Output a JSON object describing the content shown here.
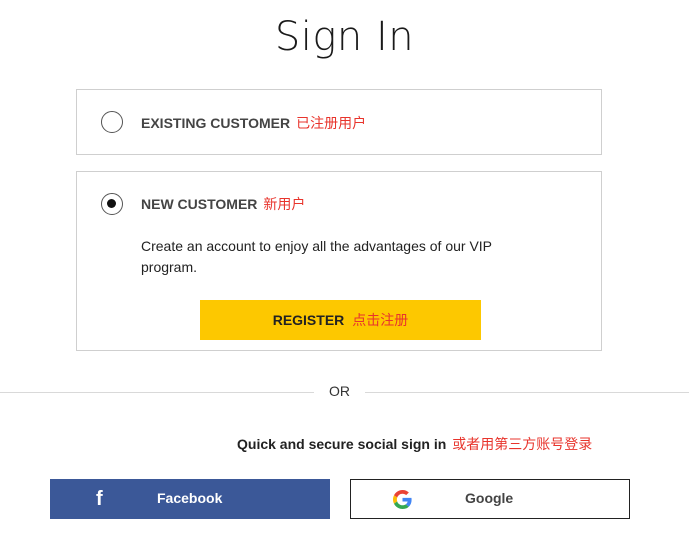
{
  "page": {
    "title": "Sign In"
  },
  "existing_customer": {
    "label": "EXISTING CUSTOMER",
    "label_cn": "已注册用户",
    "selected": false
  },
  "new_customer": {
    "label": "NEW CUSTOMER",
    "label_cn": "新用户",
    "selected": true,
    "description": "Create an account to enjoy all the advantages of our VIP program.",
    "register_label": "REGISTER",
    "register_label_cn": "点击注册"
  },
  "divider": {
    "text": "OR"
  },
  "social": {
    "caption": "Quick and secure social sign in",
    "caption_cn": "或者用第三方账号登录",
    "facebook": {
      "label": "Facebook",
      "icon": "facebook-f-icon",
      "color": "#3b5898"
    },
    "google": {
      "label": "Google",
      "icon": "google-g-icon"
    }
  },
  "colors": {
    "accent_yellow": "#fdc800",
    "annotation_red": "#e8342c",
    "facebook_blue": "#3b5898"
  }
}
